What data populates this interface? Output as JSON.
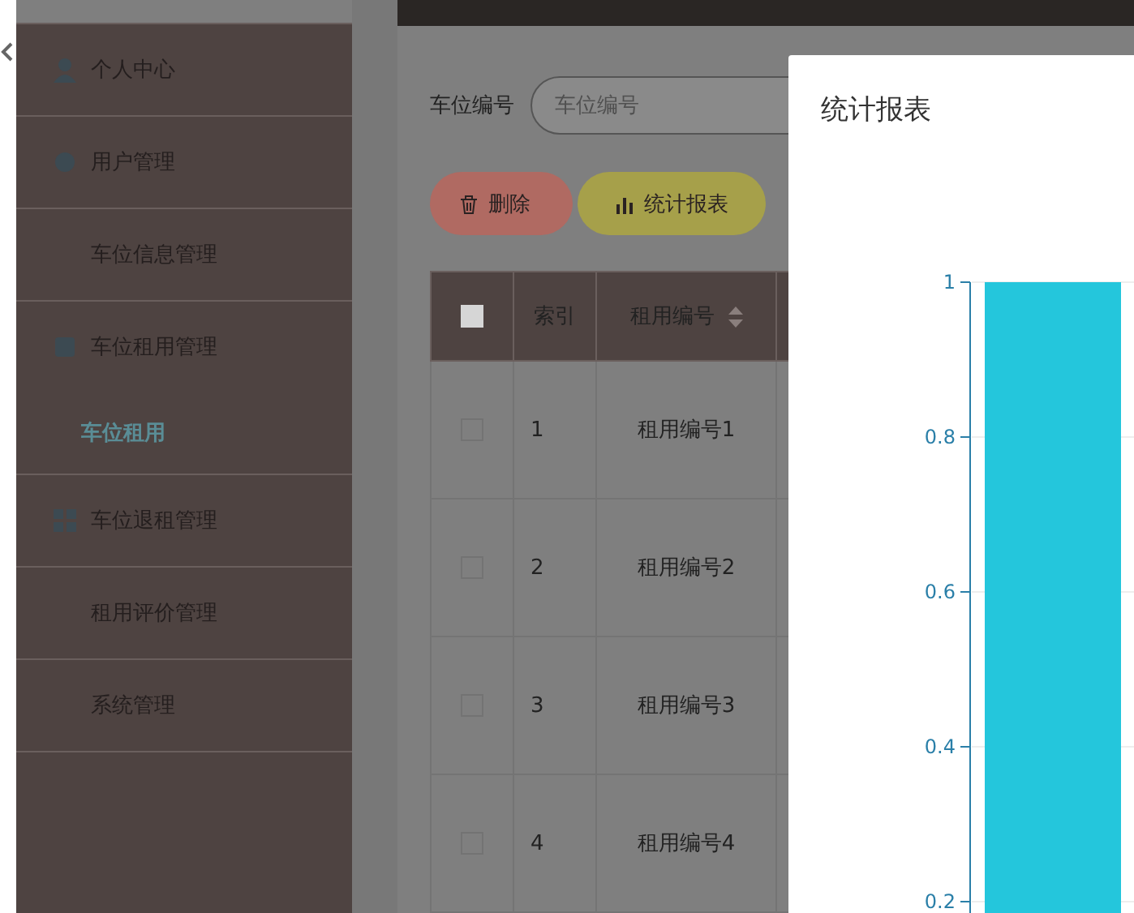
{
  "sidebar": {
    "items": [
      {
        "label": "个人中心",
        "icon": true,
        "selected": false
      },
      {
        "label": "用户管理",
        "icon": true,
        "selected": false
      },
      {
        "label": "车位信息管理",
        "icon": false,
        "selected": false
      },
      {
        "label": "车位租用管理",
        "icon": true,
        "selected": false,
        "children": [
          {
            "label": "车位租用",
            "selected": true
          }
        ]
      },
      {
        "label": "车位退租管理",
        "icon": true,
        "selected": false
      },
      {
        "label": "租用评价管理",
        "icon": false,
        "selected": false
      },
      {
        "label": "系统管理",
        "icon": false,
        "selected": false
      }
    ]
  },
  "search": {
    "label": "车位编号",
    "placeholder": "车位编号"
  },
  "buttons": [
    {
      "kind": "delete",
      "label": "删除"
    },
    {
      "kind": "report",
      "label": "统计报表"
    }
  ],
  "table": {
    "header_checked": false,
    "columns": [
      {
        "label": "索引",
        "sortable": false
      },
      {
        "label": "租用编号",
        "sortable": true
      }
    ],
    "rows": [
      {
        "checked": false,
        "index": "1",
        "rental_no": "租用编号1"
      },
      {
        "checked": false,
        "index": "2",
        "rental_no": "租用编号2"
      },
      {
        "checked": false,
        "index": "3",
        "rental_no": "租用编号3"
      },
      {
        "checked": false,
        "index": "4",
        "rental_no": "租用编号4"
      }
    ]
  },
  "modal": {
    "title": "统计报表",
    "chart_data": {
      "type": "bar",
      "grid": true,
      "ylim": [
        0,
        1
      ],
      "yticks": [
        0.2,
        0.4,
        0.6,
        0.8,
        1
      ],
      "series": [
        {
          "color": "#24c6dc",
          "values": [
            1
          ]
        }
      ]
    }
  }
}
